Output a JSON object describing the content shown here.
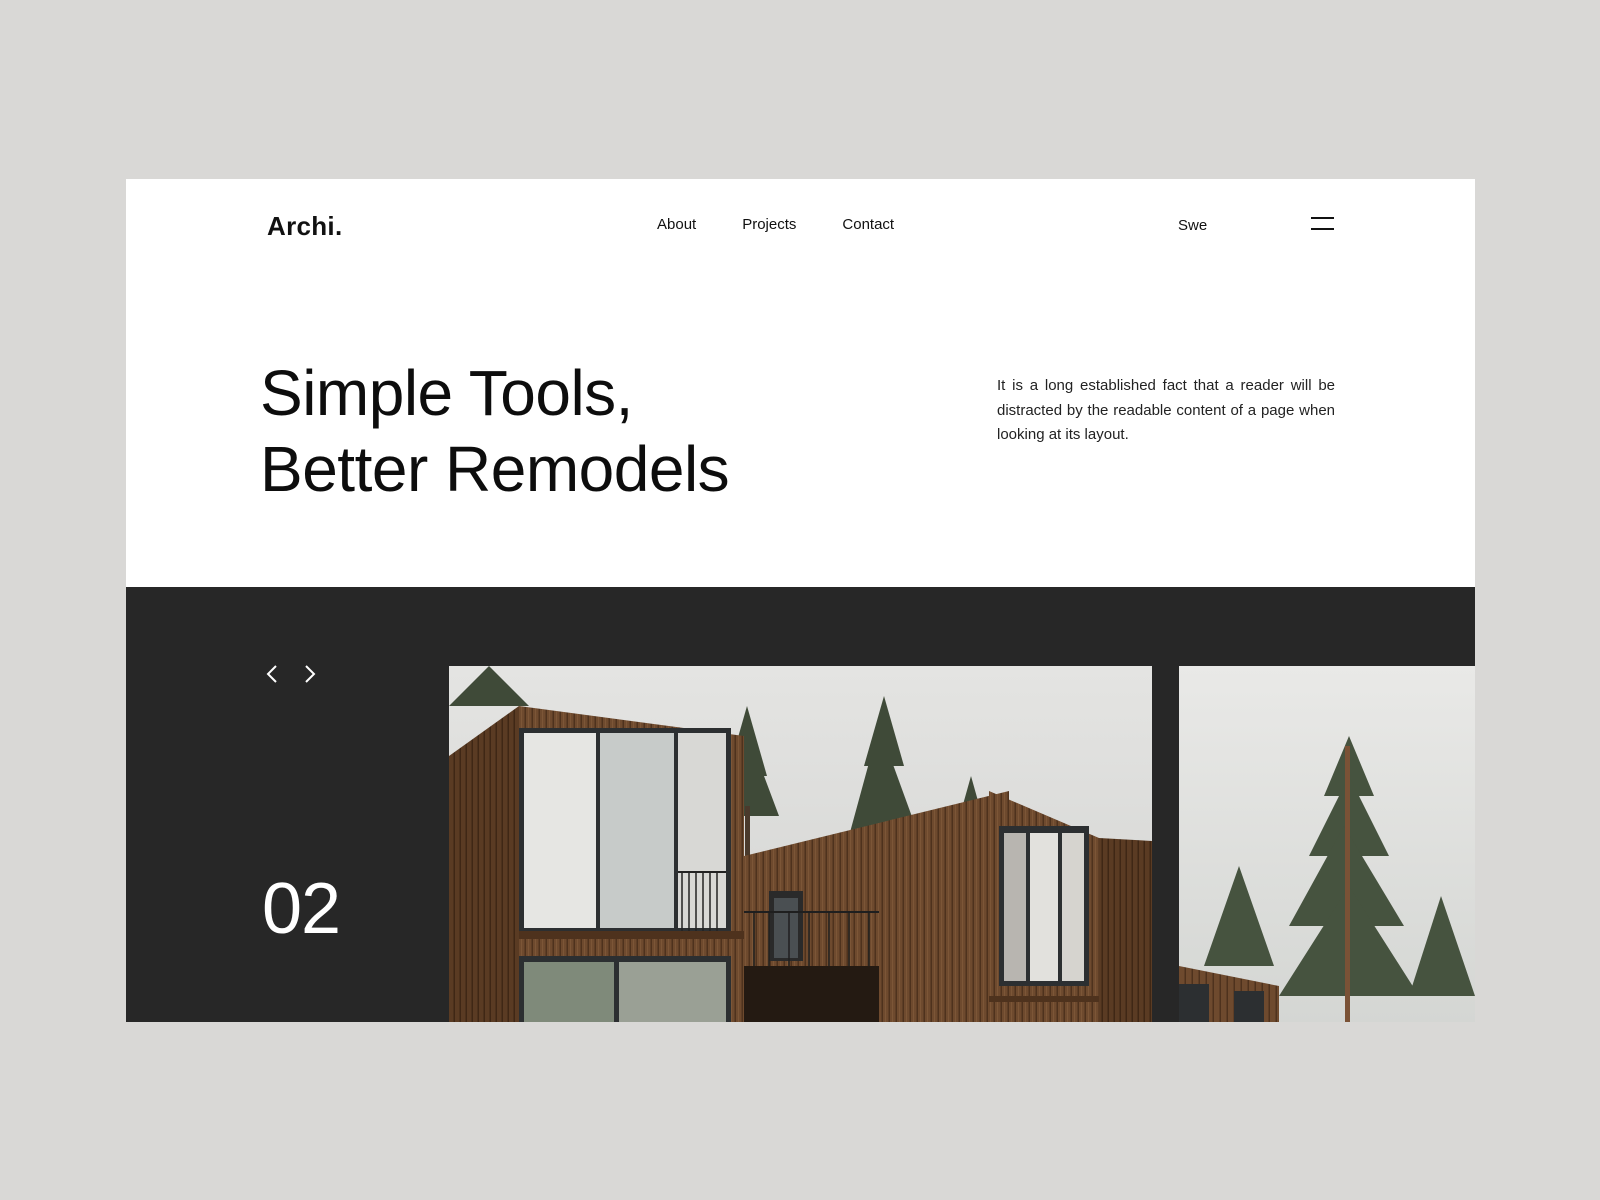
{
  "brand": {
    "logo": "Archi."
  },
  "nav": {
    "items": [
      "About",
      "Projects",
      "Contact"
    ]
  },
  "header": {
    "language": "Swe",
    "menu_icon": "hamburger-icon"
  },
  "hero": {
    "headline_line1": "Simple Tools,",
    "headline_line2": "Better Remodels",
    "description": "It is a long established fact that a reader will be distracted by the readable content of a page when looking at its layout."
  },
  "slider": {
    "prev_icon": "chevron-left-icon",
    "next_icon": "chevron-right-icon",
    "current_number": "02",
    "images": [
      "wooden-cabin-photo",
      "pine-tree-cabin-photo"
    ]
  },
  "colors": {
    "page_bg": "#d9d8d6",
    "card_bg": "#ffffff",
    "dark_band": "#272727",
    "text": "#111111",
    "wood": "#6e4a2e"
  }
}
